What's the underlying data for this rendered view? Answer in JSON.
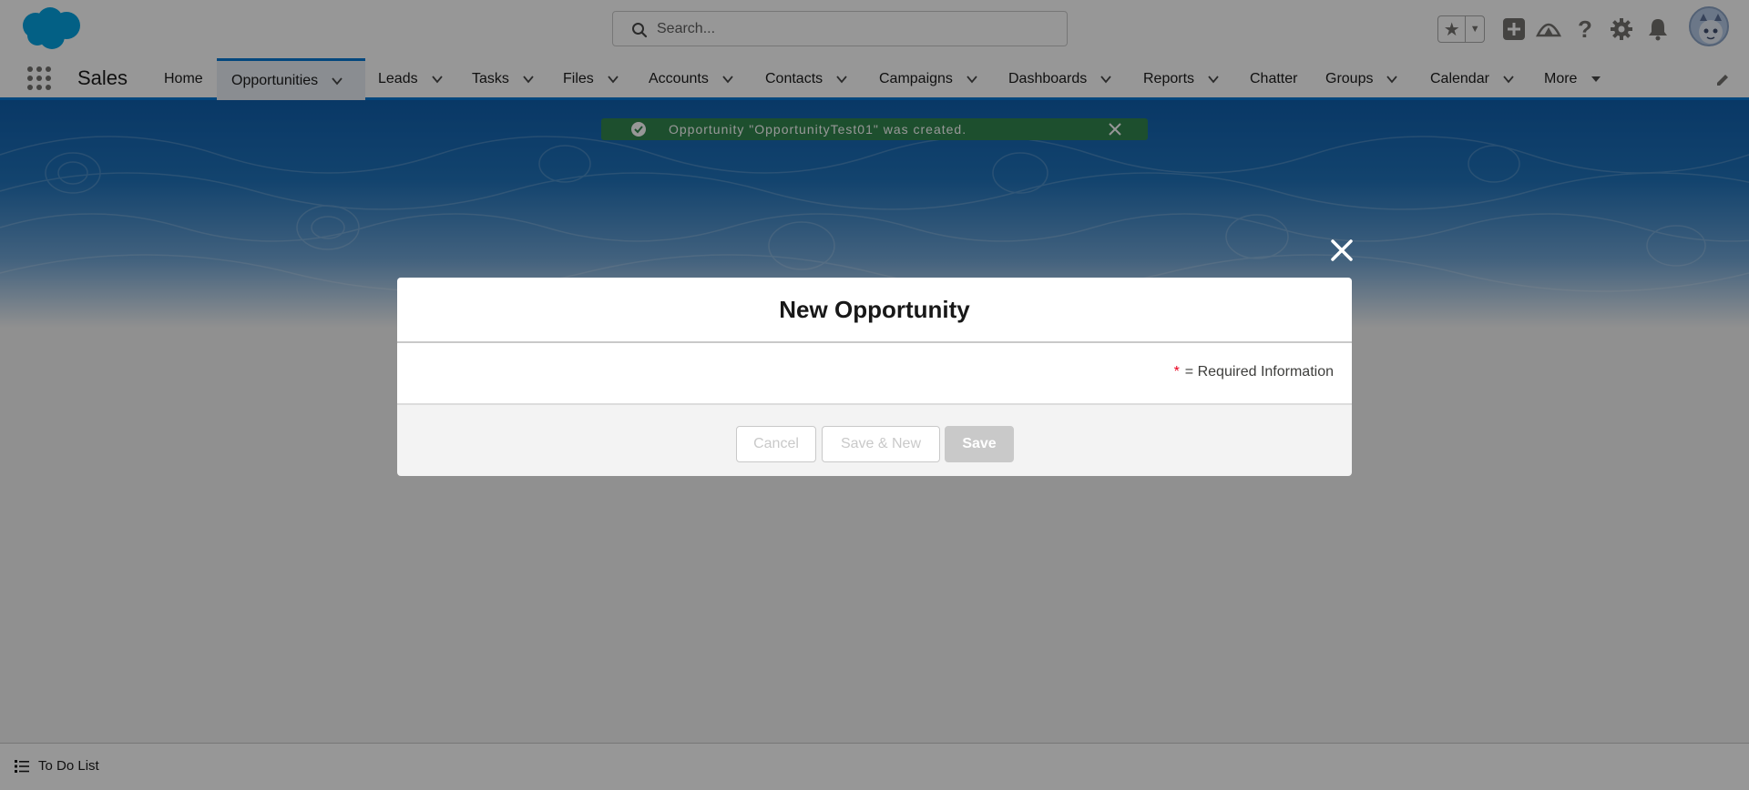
{
  "header": {
    "logo": "salesforce-cloud-logo",
    "search": {
      "placeholder": "Search..."
    },
    "icons": [
      "star-icon",
      "chevron-down-icon",
      "add-icon",
      "trailhead-icon",
      "help-icon",
      "setup-gear-icon",
      "notification-bell-icon",
      "user-avatar"
    ]
  },
  "nav": {
    "app_name": "Sales",
    "items": [
      {
        "label": "Home",
        "has_menu": false
      },
      {
        "label": "Opportunities",
        "has_menu": true,
        "active": true
      },
      {
        "label": "Leads",
        "has_menu": true
      },
      {
        "label": "Tasks",
        "has_menu": true
      },
      {
        "label": "Files",
        "has_menu": true
      },
      {
        "label": "Accounts",
        "has_menu": true
      },
      {
        "label": "Contacts",
        "has_menu": true
      },
      {
        "label": "Campaigns",
        "has_menu": true
      },
      {
        "label": "Dashboards",
        "has_menu": true
      },
      {
        "label": "Reports",
        "has_menu": true
      },
      {
        "label": "Chatter",
        "has_menu": false
      },
      {
        "label": "Groups",
        "has_menu": true
      },
      {
        "label": "Calendar",
        "has_menu": true
      },
      {
        "label": "More",
        "has_menu": true
      }
    ]
  },
  "toast": {
    "text": "Opportunity \"OpportunityTest01\" was created."
  },
  "modal": {
    "title": "New Opportunity",
    "required_star": "*",
    "required_text": "= Required Information",
    "buttons": {
      "cancel": "Cancel",
      "save_new": "Save & New",
      "save": "Save"
    }
  },
  "footer": {
    "todo_label": "To Do List"
  },
  "colors": {
    "brand": "#0176d3",
    "backdrop": "rgba(8,7,7,0.42)",
    "success": "#2e844a",
    "required": "#ea001e"
  }
}
